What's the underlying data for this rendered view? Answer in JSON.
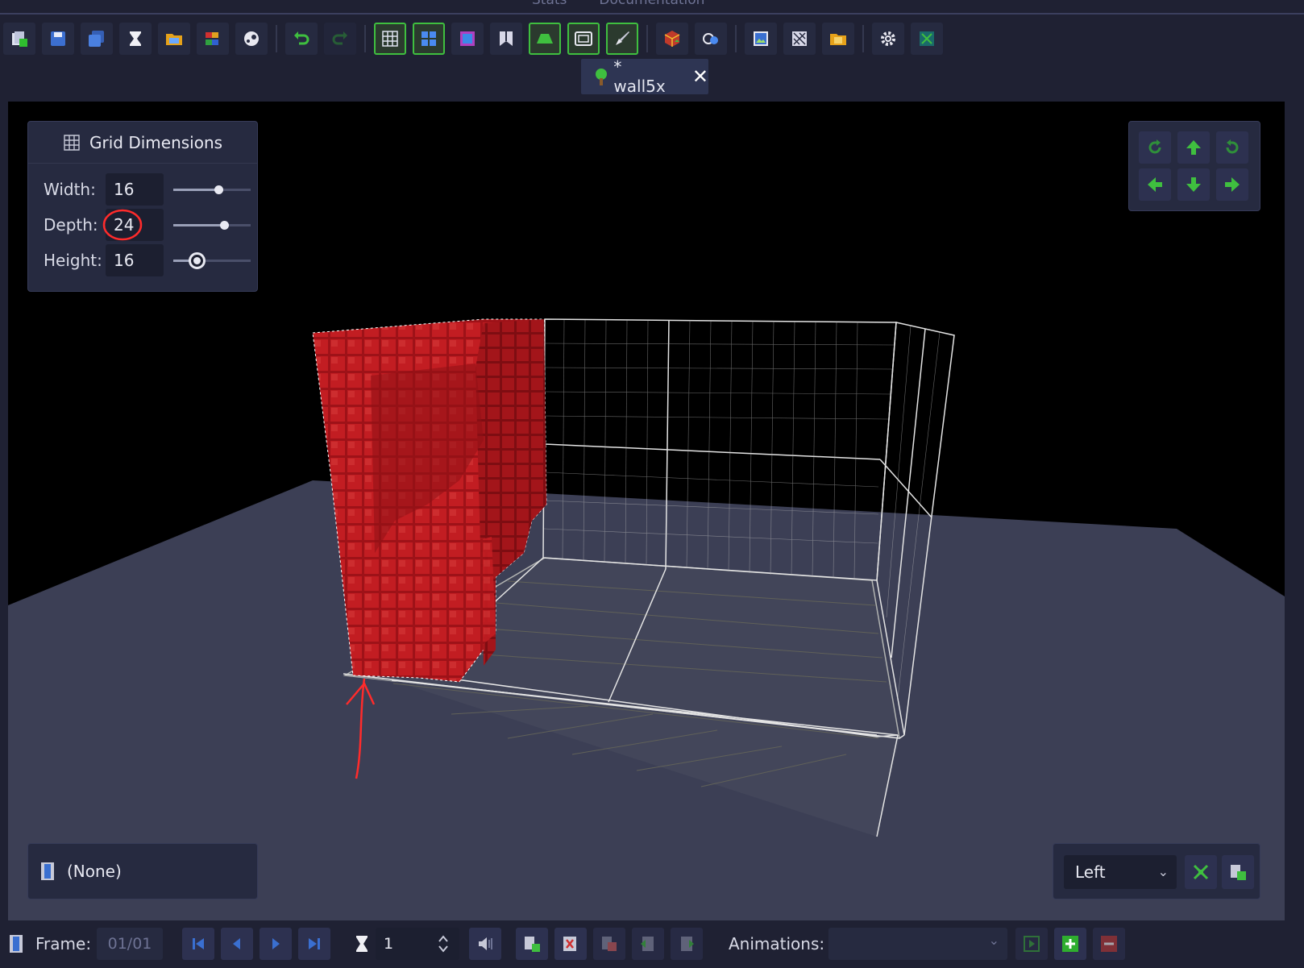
{
  "top_tabs": [
    "Stats",
    "Documentation"
  ],
  "toolbar": {
    "icons": [
      "new-file-icon",
      "save-icon",
      "save-as-icon",
      "hourglass-icon",
      "open-folder-icon",
      "palette-icon",
      "steam-icon",
      "undo-icon",
      "redo-icon",
      "grid-icon",
      "tile-grid-icon",
      "solid-cube-icon",
      "texture-icon",
      "floor-plane-icon",
      "wireframe-icon",
      "paint-brush-icon",
      "export-model-icon",
      "camera-view-icon",
      "image-icon",
      "pattern-icon",
      "folder-icon",
      "settings-icon",
      "fullscreen-icon"
    ]
  },
  "document_tab": {
    "title": "* wall5x"
  },
  "grid_dimensions": {
    "title": "Grid Dimensions",
    "width_label": "Width:",
    "width_value": "16",
    "width_level": 0.58,
    "depth_label": "Depth:",
    "depth_value": "24",
    "depth_level": 0.66,
    "height_label": "Height:",
    "height_value": "16",
    "height_level": 0.3
  },
  "palette_panel": {
    "label": "(None)"
  },
  "view_panel": {
    "selected_view": "Left"
  },
  "bottom_bar": {
    "frame_label": "Frame:",
    "frame_value": "01/01",
    "speed_value": "1",
    "animations_label": "Animations:",
    "animations_value": ""
  },
  "colors": {
    "accent_green": "#3fbf3f",
    "voxel_red": "#b3161c",
    "annotation_red": "#ff2b2b",
    "floor": "#3c3f55"
  }
}
